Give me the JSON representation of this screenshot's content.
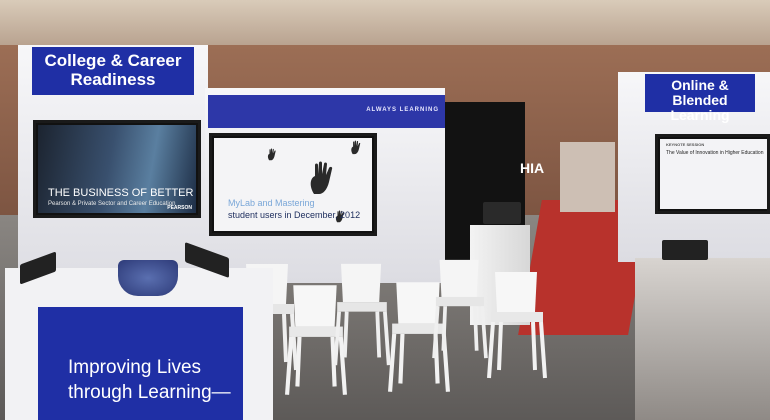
{
  "scene": {
    "signs": {
      "college_career": "College & Career Readiness",
      "online_blended": "Online & Blended Learning",
      "center_tagline": "ALWAYS LEARNING",
      "banner_text": "Improving Lives through Learning—"
    },
    "screens": {
      "left_headline": "THE BUSINESS OF BETTER",
      "left_subtext": "Pearson & Private Sector and Career Education",
      "left_brand": "PEARSON",
      "center_line1": "MyLab and Mastering",
      "center_line2": "student users in December, 2012",
      "right_kicker": "KEYNOTE SESSION",
      "right_title": "The Value of Innovation in Higher Education"
    },
    "background_text": "HIA",
    "icons": [
      "hand-print-icon"
    ],
    "colors": {
      "booth_blue": "#1f2fa5",
      "carpet_red": "#b8322c"
    }
  }
}
